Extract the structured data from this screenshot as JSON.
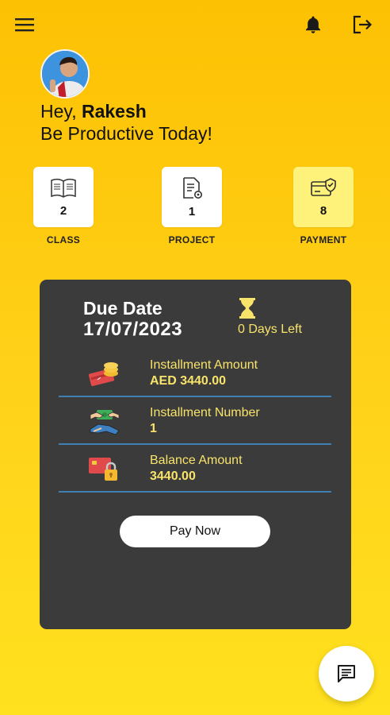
{
  "greeting": {
    "prefix": "Hey, ",
    "name": "Rakesh",
    "tagline": "Be Productive Today!"
  },
  "stats": [
    {
      "label": "CLASS",
      "count": "2",
      "icon": "book-icon"
    },
    {
      "label": "PROJECT",
      "count": "1",
      "icon": "project-document-icon"
    },
    {
      "label": "PAYMENT",
      "count": "8",
      "icon": "payment-card-icon",
      "selected": true
    }
  ],
  "card": {
    "due_title": "Due Date",
    "due_date": "17/07/2023",
    "days_left": "0 Days Left",
    "rows": [
      {
        "label": "Installment Amount",
        "value": "AED 3440.00",
        "icon": "money-card-icon"
      },
      {
        "label": "Installment Number",
        "value": "1",
        "icon": "hand-money-icon"
      },
      {
        "label": "Balance Amount",
        "value": "3440.00",
        "icon": "card-lock-icon"
      }
    ],
    "pay_button": "Pay Now"
  },
  "colors": {
    "background": "#fdc103",
    "card": "#3b3b3b",
    "accent_text": "#f8e36b",
    "divider": "#3f7fb4",
    "selected_tile": "#fff27a"
  }
}
